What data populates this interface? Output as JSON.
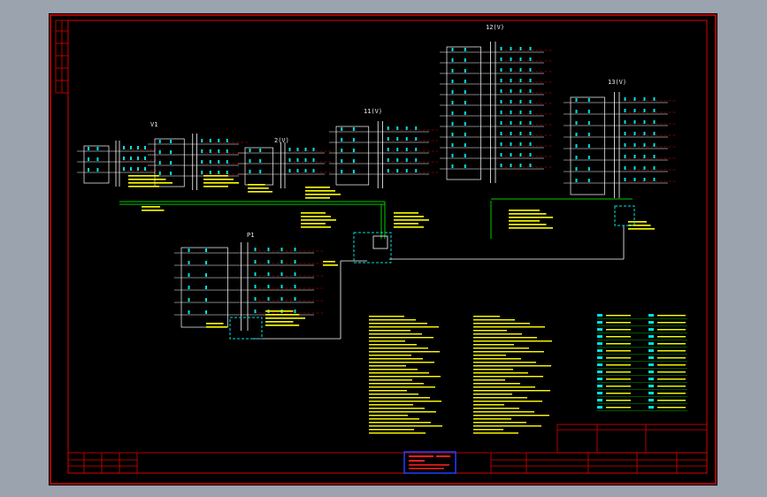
{
  "drawing": {
    "background": "#000000",
    "border_color": "#e00000",
    "line_color": "#ffffff",
    "device_color": "#00e0e0",
    "text_color": "#ffff00",
    "feeder_color": "#00cc00"
  },
  "labels": {
    "building_1": "V1",
    "building_2": "2(V)",
    "building_3": "11(V)",
    "building_4": "12(V)",
    "building_5": "13(V)",
    "building_6": "P1",
    "notes_title": "",
    "legend_title": ""
  },
  "title_block": {
    "company_line": "",
    "stamp": ""
  },
  "icons": {
    "cabinet": "distribution-cabinet-icon",
    "meter": "meter-box-icon"
  }
}
